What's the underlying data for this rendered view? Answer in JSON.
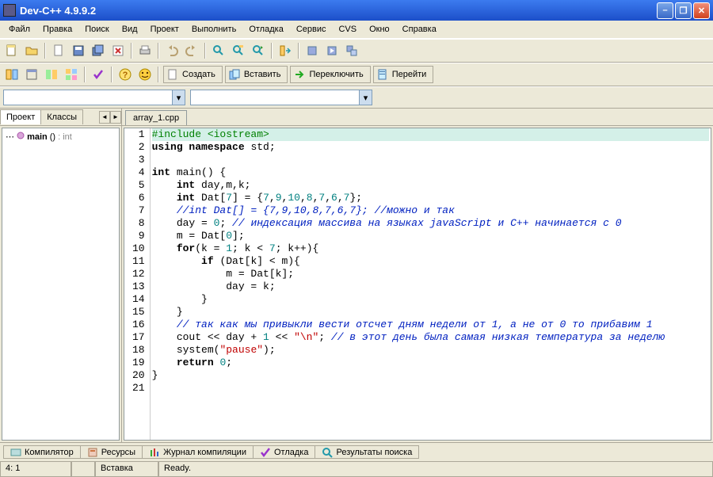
{
  "window": {
    "title": "Dev-C++ 4.9.9.2"
  },
  "menu": [
    "Файл",
    "Правка",
    "Поиск",
    "Вид",
    "Проект",
    "Выполнить",
    "Отладка",
    "Сервис",
    "CVS",
    "Окно",
    "Справка"
  ],
  "toolbar2": {
    "create": "Создать",
    "insert": "Вставить",
    "switch": "Переключить",
    "goto": "Перейти"
  },
  "sidebar": {
    "tabs": [
      "Проект",
      "Классы"
    ],
    "activeTab": 0,
    "node": {
      "name": "main",
      "sig": "()",
      "ret": ": int"
    }
  },
  "fileTab": "array_1.cpp",
  "code": {
    "lines": [
      {
        "n": 1,
        "hl": true,
        "html": "<span class='pp'>#include &lt;iostream&gt;</span>"
      },
      {
        "n": 2,
        "html": "<span class='kw'>using namespace</span> std;"
      },
      {
        "n": 3,
        "html": ""
      },
      {
        "n": 4,
        "html": "<span class='kw'>int</span> main() {"
      },
      {
        "n": 5,
        "html": "    <span class='kw'>int</span> day,m,k;"
      },
      {
        "n": 6,
        "html": "    <span class='kw'>int</span> Dat[<span class='num'>7</span>] = {<span class='num'>7</span>,<span class='num'>9</span>,<span class='num'>10</span>,<span class='num'>8</span>,<span class='num'>7</span>,<span class='num'>6</span>,<span class='num'>7</span>};"
      },
      {
        "n": 7,
        "html": "    <span class='cm'>//int Dat[] = {7,9,10,8,7,6,7}; //можно и так</span>"
      },
      {
        "n": 8,
        "html": "    day = <span class='num'>0</span>; <span class='cm'>// индексация массива на языках javaScript и C++ начинается с 0</span>"
      },
      {
        "n": 9,
        "html": "    m = Dat[<span class='num'>0</span>];"
      },
      {
        "n": 10,
        "html": "    <span class='kw'>for</span>(k = <span class='num'>1</span>; k &lt; <span class='num'>7</span>; k++){"
      },
      {
        "n": 11,
        "html": "        <span class='kw'>if</span> (Dat[k] &lt; m){"
      },
      {
        "n": 12,
        "html": "            m = Dat[k];"
      },
      {
        "n": 13,
        "html": "            day = k;"
      },
      {
        "n": 14,
        "html": "        }"
      },
      {
        "n": 15,
        "html": "    }"
      },
      {
        "n": 16,
        "html": "    <span class='cm'>// так как мы привыкли вести отсчет дням недели от 1, а не от 0 то прибавим 1</span>"
      },
      {
        "n": 17,
        "html": "    cout &lt;&lt; day + <span class='num'>1</span> &lt;&lt; <span class='str'>\"\\n\"</span>; <span class='cm'>// в этот день была самая низкая температура за неделю</span>"
      },
      {
        "n": 18,
        "html": "    system(<span class='str'>\"pause\"</span>);"
      },
      {
        "n": 19,
        "html": "    <span class='kw'>return</span> <span class='num'>0</span>;"
      },
      {
        "n": 20,
        "html": "}"
      },
      {
        "n": 21,
        "html": ""
      }
    ]
  },
  "bottomTabs": [
    "Компилятор",
    "Ресурсы",
    "Журнал компиляции",
    "Отладка",
    "Результаты поиска"
  ],
  "status": {
    "pos": "4: 1",
    "col2": "",
    "mode": "Вставка",
    "msg": "Ready."
  }
}
